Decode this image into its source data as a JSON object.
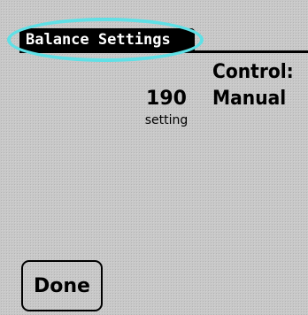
{
  "window": {
    "title": "Balance Settings"
  },
  "setting": {
    "value": "190",
    "caption": "setting"
  },
  "control": {
    "label": "Control:",
    "value": "Manual"
  },
  "buttons": {
    "done_label": "Done"
  },
  "colors": {
    "background": "#c8c8c8",
    "title_bar": "#000000",
    "highlight_ring": "#5fe0e6"
  }
}
